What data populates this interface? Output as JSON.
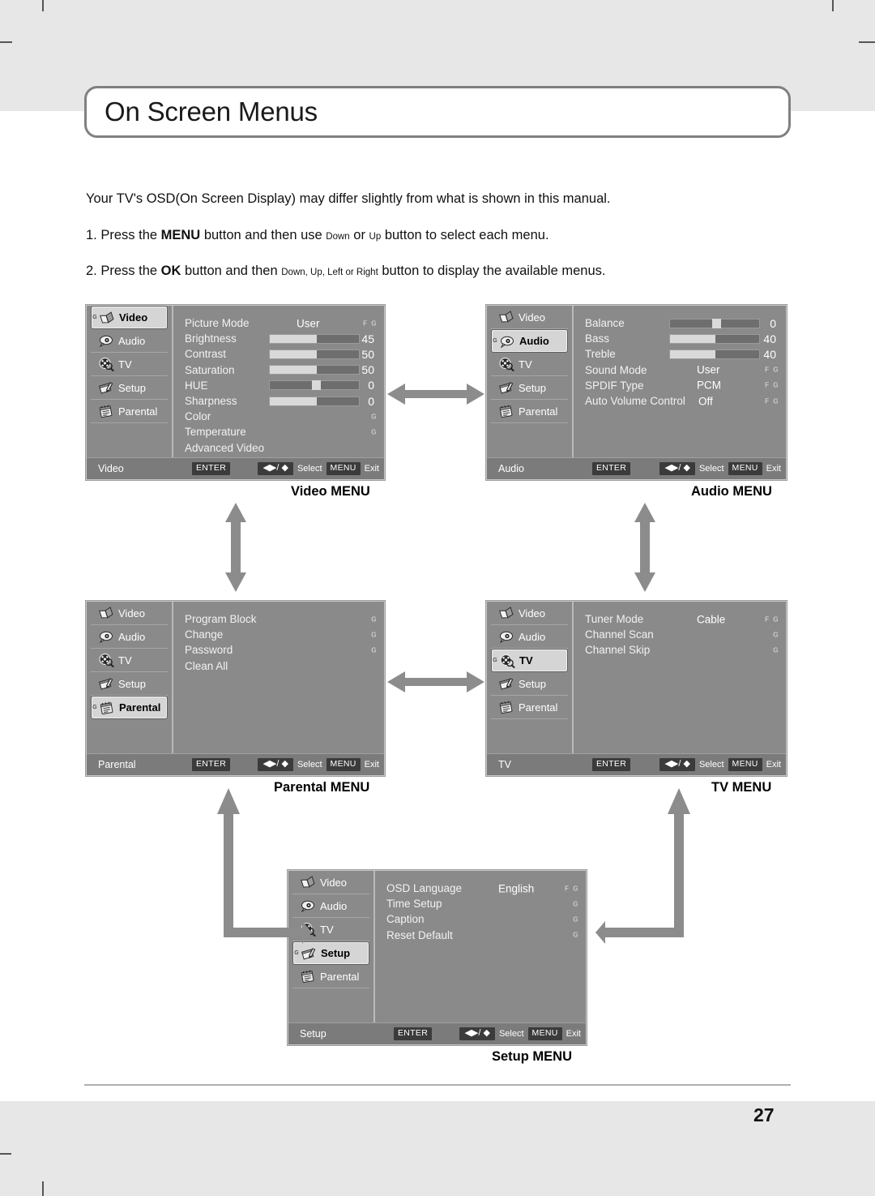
{
  "page": {
    "title": "On Screen Menus",
    "page_number": "27",
    "intro_line": "Your TV's OSD(On Screen Display) may differ slightly from what is shown in this manual.",
    "step1": {
      "prefix": "1. Press the ",
      "key": "MENU",
      "mid": " button and then use ",
      "small1": "Down",
      "or": " or ",
      "small2": "Up",
      "suffix": " button to select each menu."
    },
    "step2": {
      "prefix": "2. Press the ",
      "key": "OK",
      "mid": " button and then ",
      "small1": "Down, Up, Left or Right",
      "suffix": " button to display the available menus."
    }
  },
  "osd_common": {
    "sidebar": [
      {
        "label": "Video",
        "icon": "video-book-icon"
      },
      {
        "label": "Audio",
        "icon": "audio-speaker-icon"
      },
      {
        "label": "TV",
        "icon": "tv-reel-icon"
      },
      {
        "label": "Setup",
        "icon": "setup-pencil-icon"
      },
      {
        "label": "Parental",
        "icon": "parental-clipboard-icon"
      }
    ],
    "g_badge": "G",
    "footer": {
      "enter_key": "ENTER",
      "arrows_key": "◀▶/ ◆",
      "select_word": "Select",
      "menu_key": "MENU",
      "exit_word": "Exit"
    },
    "fg_both": "F G",
    "fg_g": "G"
  },
  "panels": {
    "video": {
      "selected": "Video",
      "footer_title": "Video",
      "caption": "Video MENU",
      "rows": [
        {
          "label": "Picture Mode",
          "value": "User",
          "marker": "F G",
          "type": "value"
        },
        {
          "label": "Brightness",
          "number": "45",
          "type": "slider",
          "fill_pct": 53
        },
        {
          "label": "Contrast",
          "number": "50",
          "type": "slider",
          "fill_pct": 53
        },
        {
          "label": "Saturation",
          "number": "50",
          "type": "slider",
          "fill_pct": 53
        },
        {
          "label": "HUE",
          "number": "0",
          "type": "slider_thumb",
          "thumb_pct": 47
        },
        {
          "label": "Sharpness",
          "number": "0",
          "type": "slider",
          "fill_pct": 53
        },
        {
          "label": "Color",
          "marker": "G",
          "type": "plain"
        },
        {
          "label": "Temperature",
          "marker": "G",
          "type": "plain"
        },
        {
          "label": "Advanced Video",
          "type": "plain"
        }
      ]
    },
    "audio": {
      "selected": "Audio",
      "footer_title": "Audio",
      "caption": "Audio MENU",
      "rows": [
        {
          "label": "Balance",
          "number": "0",
          "type": "slider_thumb",
          "thumb_pct": 47
        },
        {
          "label": "Bass",
          "number": "40",
          "type": "slider",
          "fill_pct": 51
        },
        {
          "label": "Treble",
          "number": "40",
          "type": "slider",
          "fill_pct": 51
        },
        {
          "label": "Sound Mode",
          "value": "User",
          "marker": "F G",
          "type": "value"
        },
        {
          "label": "SPDIF Type",
          "value": "PCM",
          "marker": "F G",
          "type": "value"
        },
        {
          "label": "Auto Volume Control",
          "value": "Off",
          "marker": "F G",
          "type": "value_wide"
        }
      ]
    },
    "parental": {
      "selected": "Parental",
      "footer_title": "Parental",
      "caption": "Parental MENU",
      "rows": [
        {
          "label": "Program Block",
          "marker": "G",
          "type": "plain"
        },
        {
          "label": "Change",
          "marker": "G",
          "type": "plain"
        },
        {
          "label": "Password",
          "marker": "G",
          "type": "plain"
        },
        {
          "label": "Clean All",
          "type": "plain"
        }
      ]
    },
    "tv": {
      "selected": "TV",
      "footer_title": "TV",
      "caption": "TV MENU",
      "rows": [
        {
          "label": "Tuner Mode",
          "value": "Cable",
          "marker": "F G",
          "type": "value"
        },
        {
          "label": "Channel Scan",
          "marker": "G",
          "type": "plain"
        },
        {
          "label": "Channel Skip",
          "marker": "G",
          "type": "plain"
        }
      ]
    },
    "setup": {
      "selected": "Setup",
      "footer_title": "Setup",
      "caption": "Setup MENU",
      "rows": [
        {
          "label": "OSD Language",
          "value": "English",
          "marker": "F G",
          "type": "value"
        },
        {
          "label": "Time Setup",
          "marker": "G",
          "type": "plain"
        },
        {
          "label": "Caption",
          "marker": "G",
          "type": "plain"
        },
        {
          "label": "Reset Default",
          "marker": "G",
          "type": "plain"
        }
      ]
    }
  },
  "colors": {
    "panel_bg": "#8a8a8a",
    "panel_foot": "#7b7b7b",
    "selected_item": "#d5d5d5",
    "arrow_gray": "#8c8c8c",
    "page_band": "#e7e7e7"
  }
}
